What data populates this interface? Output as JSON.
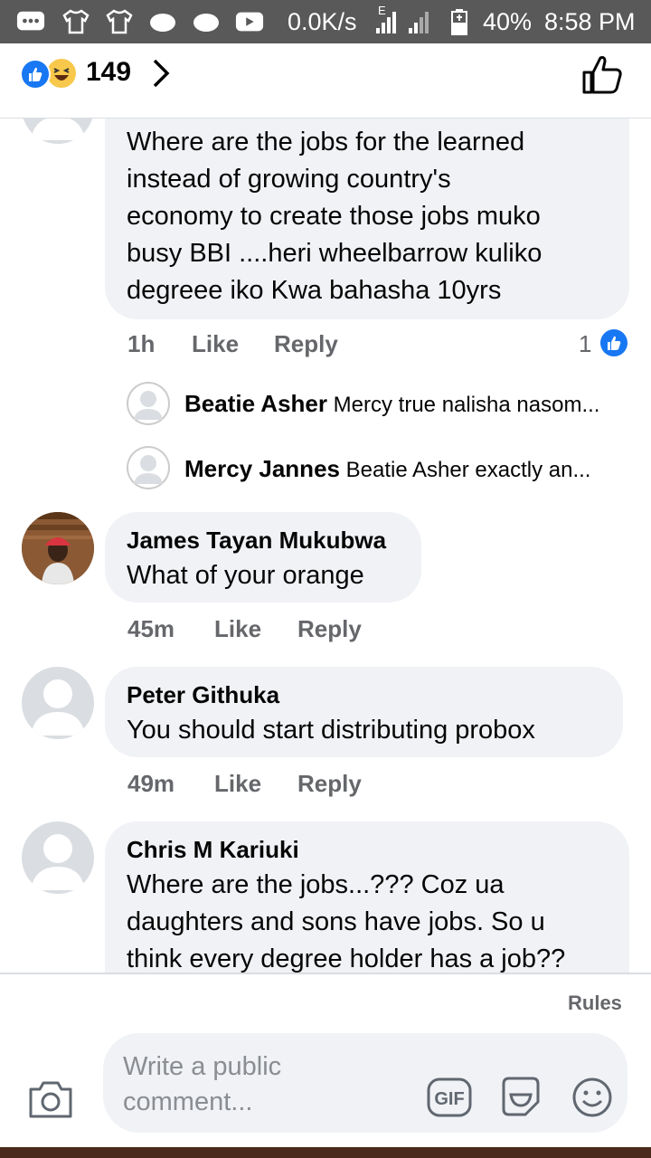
{
  "status_bar": {
    "network_speed": "0.0K/s",
    "network_type": "E",
    "battery": "40%",
    "time": "8:58 PM",
    "icons": [
      "chat-icon",
      "shirt-icon",
      "shirt-icon",
      "cloud-icon",
      "cloud-icon",
      "youtube-icon",
      "signal-icon",
      "battery-icon"
    ]
  },
  "header": {
    "reaction_icons": [
      "like-reaction-icon",
      "haha-reaction-icon"
    ],
    "reaction_count": "149"
  },
  "comments": [
    {
      "name": "",
      "text_lines": [
        "Where are the jobs for the learned",
        "instead of growing country's",
        "economy to create those jobs  muko",
        "busy BBI ....heri wheelbarrow kuliko",
        "degreee iko Kwa bahasha 10yrs"
      ],
      "time": "1h",
      "like": "Like",
      "reply": "Reply",
      "like_count": "1",
      "replies": [
        {
          "name": "Beatie Asher",
          "text": "Mercy true nalisha nasom..."
        },
        {
          "name": "Mercy Jannes",
          "text": "Beatie Asher exactly an..."
        }
      ]
    },
    {
      "name": "James Tayan Mukubwa",
      "text": "What of your orange",
      "time": "45m",
      "like": "Like",
      "reply": "Reply"
    },
    {
      "name": "Peter Githuka",
      "text": "You should start distributing probox",
      "time": "49m",
      "like": "Like",
      "reply": "Reply"
    },
    {
      "name": "Chris M Kariuki",
      "text_lines": [
        "Where are the jobs...??? Coz ua",
        "daughters and sons have jobs.  So u",
        "think every degree holder has a job??"
      ]
    }
  ],
  "footer": {
    "rules": "Rules",
    "placeholder": "Write a public comment..."
  },
  "colors": {
    "accent": "#1877f2",
    "bubble": "#f0f2f5",
    "meta": "#65676b",
    "status_bar": "#595959"
  }
}
